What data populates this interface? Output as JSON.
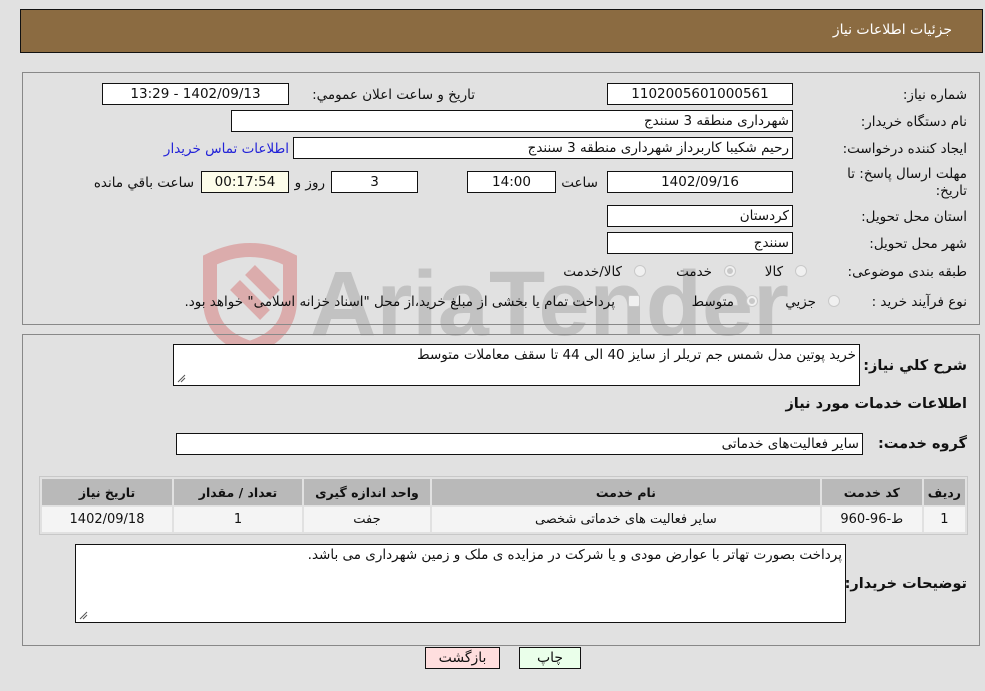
{
  "header": {
    "title": "جزئیات اطلاعات نیاز"
  },
  "form": {
    "need_number": {
      "label": "شماره نیاز:",
      "value": "1102005601000561"
    },
    "announce_datetime": {
      "label": "تاریخ و ساعت اعلان عمومي:",
      "value": "1402/09/13 - 13:29"
    },
    "buyer_org": {
      "label": "نام دستگاه خریدار:",
      "value": "شهرداری منطقه 3 سنندج"
    },
    "requester": {
      "label": "ایجاد کننده درخواست:",
      "value": "رحیم شکیبا کاربرداز شهرداری منطقه 3 سنندج"
    },
    "buyer_contact_link": "اطلاعات تماس خریدار",
    "deadline": {
      "label_line1": "مهلت ارسال پاسخ: تا",
      "label_line2": "تاریخ:",
      "date": "1402/09/16",
      "time_label": "ساعت",
      "time": "14:00",
      "days": "3",
      "days_label": "روز و",
      "remaining": "00:17:54",
      "remaining_label": "ساعت باقي مانده"
    },
    "province": {
      "label": "استان محل تحویل:",
      "value": "کردستان"
    },
    "city": {
      "label": "شهر محل تحویل:",
      "value": "سنندج"
    },
    "category": {
      "label": "طبقه بندی موضوعی:",
      "options": [
        "کالا",
        "خدمت",
        "کالا/خدمت"
      ],
      "selected": "خدمت"
    },
    "purchase_type": {
      "label": "نوع فرآیند خرید :",
      "options": [
        "جزيي",
        "متوسط"
      ],
      "selected": "متوسط",
      "treasury_note": "پرداخت تمام یا بخشی از مبلغ خرید،از محل \"اسناد خزانه اسلامی\" خواهد بود."
    }
  },
  "details": {
    "summary_label": "شرح کلي نیاز:",
    "summary_value": "خرید پوتین مدل شمس جم تریلر از سایز 40 الی 44 تا سقف معاملات متوسط",
    "services_heading": "اطلاعات خدمات مورد نیاز",
    "service_group_label": "گروه خدمت:",
    "service_group_value": "سایر فعالیت‌های خدماتی",
    "table": {
      "headers": [
        "ردیف",
        "کد خدمت",
        "نام خدمت",
        "واحد اندازه گیری",
        "تعداد / مقدار",
        "تاریخ نیاز"
      ],
      "rows": [
        [
          "1",
          "ط-96-960",
          "سایر فعالیت های خدماتی شخصی",
          "جفت",
          "1",
          "1402/09/18"
        ]
      ]
    },
    "buyer_notes_label": "توضیحات خریدار:",
    "buyer_notes_value": "پرداخت بصورت تهاتر با عوارض مودی و یا شرکت در مزایده ی ملک و زمین شهرداری می باشد."
  },
  "buttons": {
    "print": "چاپ",
    "back": "بازگشت"
  },
  "colors": {
    "header_bg": "#8b6b41",
    "print_bg": "#eaffea",
    "back_bg": "#ffdede",
    "link": "#2323d8"
  },
  "watermark": {
    "text": "AriaTender.neT"
  }
}
